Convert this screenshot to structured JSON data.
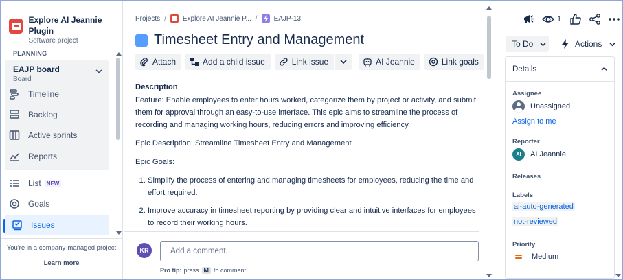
{
  "sidebar": {
    "project_name": "Explore AI Jeannie Plugin",
    "project_type": "Software project",
    "section_label": "PLANNING",
    "board_title": "EAJP board",
    "board_subtitle": "Board",
    "items": [
      {
        "label": "Timeline",
        "icon": "timeline-icon"
      },
      {
        "label": "Backlog",
        "icon": "backlog-icon"
      },
      {
        "label": "Active sprints",
        "icon": "board-columns-icon"
      },
      {
        "label": "Reports",
        "icon": "chart-icon"
      },
      {
        "label": "List",
        "icon": "list-icon",
        "badge": "NEW"
      },
      {
        "label": "Goals",
        "icon": "target-icon"
      },
      {
        "label": "Issues",
        "icon": "issues-icon",
        "active": true
      }
    ],
    "footer_text": "You're in a company-managed project",
    "footer_link": "Learn more"
  },
  "breadcrumb": {
    "projects": "Projects",
    "project": "Explore AI Jeannie P...",
    "issue_key": "EAJP-13"
  },
  "issue": {
    "title": "Timesheet Entry and Management",
    "toolbar": {
      "attach": "Attach",
      "add_child": "Add a child issue",
      "link_issue": "Link issue",
      "ai_jeannie": "AI Jeannie",
      "link_goals": "Link goals"
    },
    "description": {
      "heading": "Description",
      "p1": "Feature: Enable employees to enter hours worked, categorize them by project or activity, and submit them for approval through an easy-to-use interface. This epic aims to streamline the process of recording and managing working hours, reducing errors and improving efficiency.",
      "p2": "Epic Description:  Streamline Timesheet Entry and Management",
      "p3": "Epic Goals:",
      "goals": [
        "Simplify the process of entering and managing timesheets for employees, reducing the time and effort required.",
        "Improve accuracy in timesheet reporting by providing clear and intuitive interfaces for employees to record their working hours."
      ]
    }
  },
  "comment": {
    "avatar_initials": "KR",
    "placeholder": "Add a comment...",
    "protip_bold": "Pro tip:",
    "protip_press": "press",
    "protip_key": "M",
    "protip_rest": "to comment"
  },
  "right_panel": {
    "watch_count": "1",
    "status": "To Do",
    "actions": "Actions",
    "details_title": "Details",
    "assignee_label": "Assignee",
    "assignee_value": "Unassigned",
    "assign_to_me": "Assign to me",
    "reporter_label": "Reporter",
    "reporter_initials": "AI",
    "reporter_value": "AI Jeannie",
    "releases_label": "Releases",
    "labels_label": "Labels",
    "labels": [
      "ai-auto-generated",
      "not-reviewed"
    ],
    "priority_label": "Priority",
    "priority_value": "Medium"
  },
  "colors": {
    "accent": "#0c66e4",
    "epic_square": "#579dff",
    "project_icon": "#e2483d",
    "priority_medium": "#e56910"
  }
}
